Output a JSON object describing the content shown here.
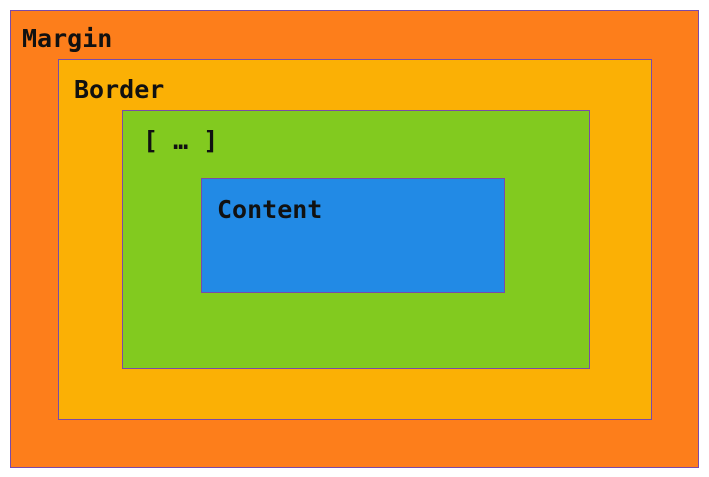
{
  "diagram": {
    "layers": [
      {
        "id": "margin",
        "label": "Margin",
        "color": "#fd7e1b"
      },
      {
        "id": "border",
        "label": "Border",
        "color": "#fbb005"
      },
      {
        "id": "middle",
        "label": "[ … ]",
        "color": "#82ca1f"
      },
      {
        "id": "content",
        "label": "Content",
        "color": "#228ae5"
      }
    ],
    "outline_color": "#7a4ba8"
  }
}
